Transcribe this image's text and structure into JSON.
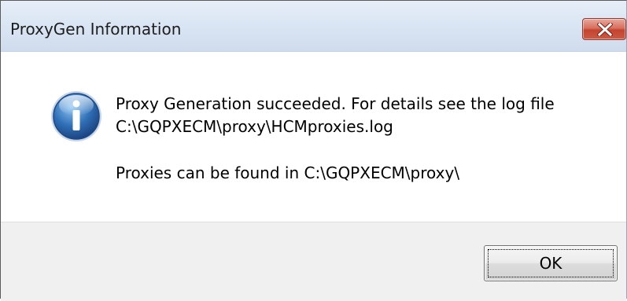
{
  "window": {
    "title": "ProxyGen Information"
  },
  "message": {
    "line1": "Proxy Generation succeeded. For details see the log file",
    "line2": "C:\\GQPXECM\\proxy\\HCMproxies.log",
    "line3": "Proxies can be found in C:\\GQPXECM\\proxy\\"
  },
  "buttons": {
    "ok_label": "OK"
  },
  "icons": {
    "info": "information-icon",
    "close": "close-icon"
  },
  "colors": {
    "close_button": "#c9513d",
    "info_icon": "#2f6fb6",
    "footer_bg": "#f0f0f0"
  }
}
